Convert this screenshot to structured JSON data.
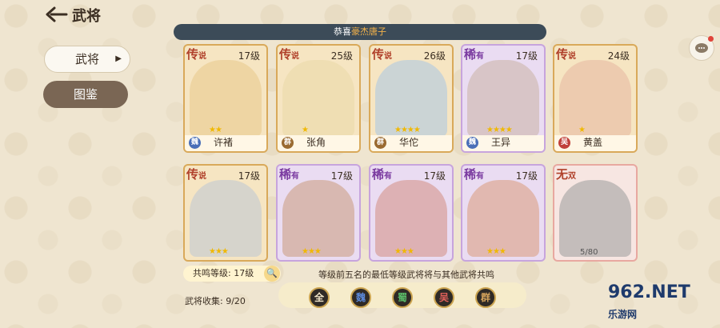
{
  "header": {
    "title": "武将"
  },
  "notice": {
    "prefix": "恭喜",
    "highlight": "豪杰唐子"
  },
  "tabs": [
    {
      "label": "武将"
    },
    {
      "label": "图鉴"
    }
  ],
  "cards": [
    {
      "rarity": "传",
      "rarity_small": "说",
      "level": "17级",
      "stars": "★★",
      "faction": "魏",
      "name": "许褚"
    },
    {
      "rarity": "传",
      "rarity_small": "说",
      "level": "25级",
      "stars": "★",
      "faction": "群",
      "name": "张角"
    },
    {
      "rarity": "传",
      "rarity_small": "说",
      "level": "26级",
      "stars": "★★★★",
      "faction": "群",
      "name": "华佗"
    },
    {
      "rarity": "稀",
      "rarity_small": "有",
      "level": "17级",
      "stars": "★★★★",
      "faction": "魏",
      "name": "王异"
    },
    {
      "rarity": "传",
      "rarity_small": "说",
      "level": "24级",
      "stars": "★",
      "faction": "吴",
      "name": "黄盖"
    },
    {
      "rarity": "传",
      "rarity_small": "说",
      "level": "17级",
      "stars": "★★★",
      "faction": "",
      "name": ""
    },
    {
      "rarity": "稀",
      "rarity_small": "有",
      "level": "17级",
      "stars": "★★★",
      "faction": "",
      "name": ""
    },
    {
      "rarity": "稀",
      "rarity_small": "有",
      "level": "17级",
      "stars": "★★★",
      "faction": "",
      "name": ""
    },
    {
      "rarity": "稀",
      "rarity_small": "有",
      "level": "17级",
      "stars": "★★★",
      "faction": "",
      "name": ""
    },
    {
      "rarity": "无",
      "rarity_small": "双",
      "level": "",
      "stars": "",
      "faction": "",
      "name": "",
      "count": "5/80"
    }
  ],
  "footer": {
    "resonance_level": "共鸣等级: 17级",
    "hint": "等级前五名的最低等级武将将与其他武将共鸣",
    "collection": "武将收集: 9/20",
    "factions": [
      "全",
      "魏",
      "蜀",
      "吴",
      "群"
    ]
  },
  "watermark": {
    "text": "962.NET",
    "sub": "乐游网"
  },
  "colors": {
    "faction_wei": "#4a6fb8",
    "faction_qun": "#9a6a30",
    "faction_wu": "#c0403a",
    "faction_shu": "#3a8a4a"
  }
}
